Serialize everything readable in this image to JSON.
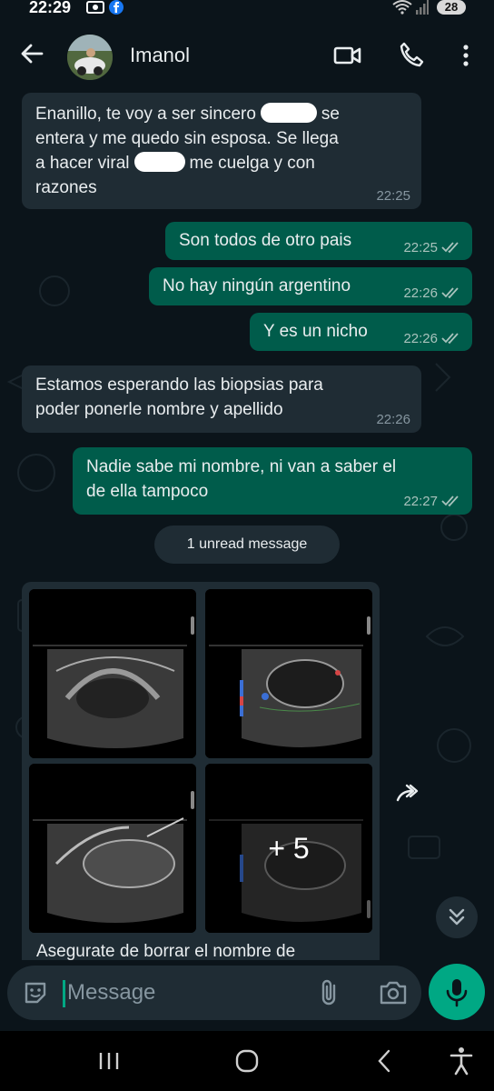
{
  "status_bar": {
    "time": "22:29",
    "battery": "28",
    "icons": [
      "photo-icon",
      "facebook-icon",
      "wifi-icon",
      "signal-icon"
    ]
  },
  "header": {
    "contact_name": "Imanol",
    "icons": [
      "back-arrow-icon",
      "video-call-icon",
      "phone-icon",
      "more-vert-icon"
    ]
  },
  "messages": [
    {
      "direction": "in",
      "lines": [
        "Enanillo, te voy a ser sincero",
        "se",
        "entera y me quedo sin esposa. Se llega",
        "a hacer viral",
        "me cuelga y con",
        "razones"
      ],
      "time": "22:25"
    },
    {
      "direction": "out",
      "text": "Son todos de otro pais",
      "time": "22:25",
      "status": "read"
    },
    {
      "direction": "out",
      "text": "No hay ningún argentino",
      "time": "22:26",
      "status": "read"
    },
    {
      "direction": "out",
      "text": "Y es un nicho",
      "time": "22:26",
      "status": "read"
    },
    {
      "direction": "in",
      "lines": [
        "Estamos esperando las biopsias para",
        "poder ponerle nombre y apellido"
      ],
      "time": "22:26"
    },
    {
      "direction": "out",
      "lines": [
        "Nadie sabe mi nombre, ni van a saber el",
        "de ella tampoco"
      ],
      "time": "22:27",
      "status": "read"
    }
  ],
  "unread_divider": "1 unread message",
  "album": {
    "images": [
      "ultrasound-image-1",
      "ultrasound-image-2",
      "ultrasound-image-3",
      "ultrasound-image-4"
    ],
    "more_count": "+ 5",
    "caption": "Asegurate de borrar el nombre de"
  },
  "input": {
    "placeholder": "Message"
  },
  "colors": {
    "background": "#0b141a",
    "incoming_bubble": "#1f2c34",
    "outgoing_bubble": "#005c4b",
    "accent": "#00a884",
    "read_ticks": "#a9c3bd"
  },
  "nav_icons": [
    "recent-apps-icon",
    "home-icon",
    "back-icon",
    "accessibility-icon"
  ]
}
